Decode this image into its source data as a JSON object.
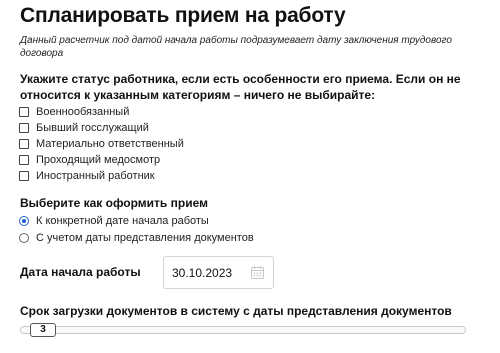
{
  "title": "Спланировать прием на работу",
  "note": "Данный расчетчик под датой начала работы подразумевает дату заключения трудового договора",
  "status_section": {
    "heading": "Укажите статус работника, если есть особенности его приема. Если он не относится к указанным категориям – ничего не выбирайте:",
    "options": [
      {
        "label": "Военнообязанный",
        "checked": false
      },
      {
        "label": "Бывший госслужащий",
        "checked": false
      },
      {
        "label": "Материально ответственный",
        "checked": false
      },
      {
        "label": "Проходящий медосмотр",
        "checked": false
      },
      {
        "label": "Иностранный работник",
        "checked": false
      }
    ]
  },
  "method_section": {
    "heading": "Выберите как оформить прием",
    "options": [
      {
        "label": "К конкретной дате начала работы",
        "selected": true
      },
      {
        "label": "С учетом даты представления документов",
        "selected": false
      }
    ]
  },
  "start_date": {
    "label": "Дата начала работы",
    "value": "30.10.2023",
    "icon": "calendar-icon"
  },
  "upload_period": {
    "label": "Срок загрузки документов в систему с даты представления документов",
    "value": "3"
  },
  "colors": {
    "accent": "#1d5fd6",
    "border": "#d4d4d4",
    "text": "#111111"
  }
}
